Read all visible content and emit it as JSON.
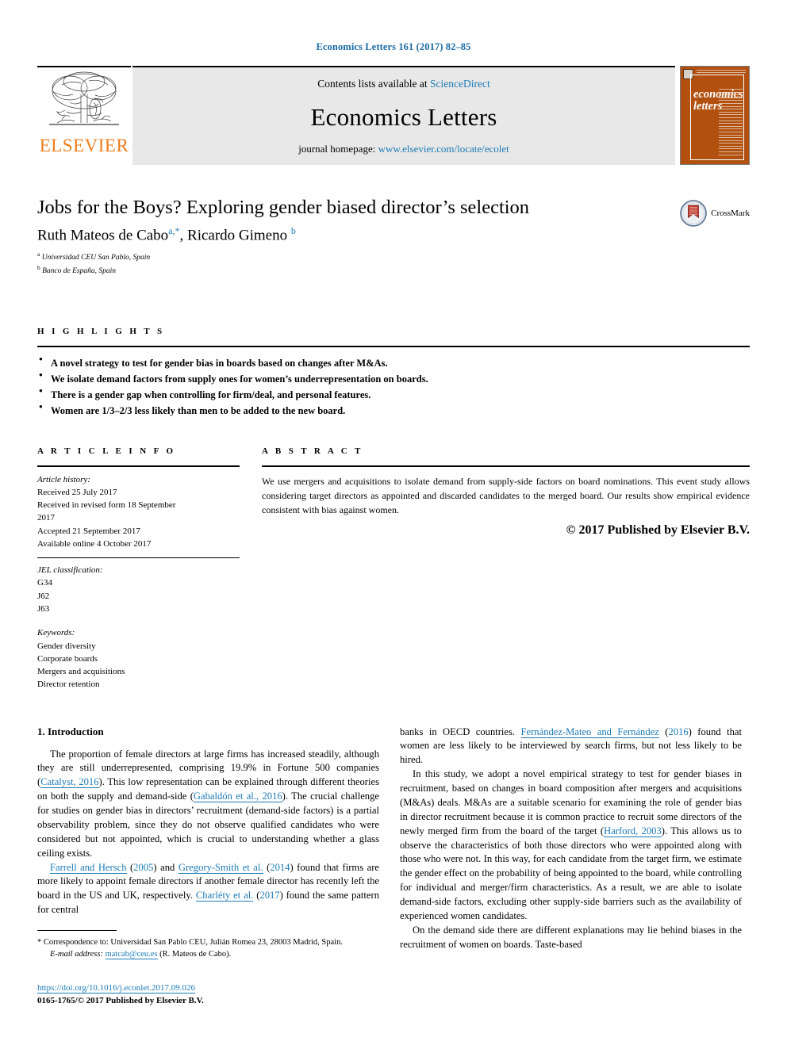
{
  "running_head": "Economics Letters 161 (2017) 82–85",
  "masthead": {
    "publisher": "ELSEVIER",
    "contents_prefix": "Contents lists available at",
    "contents_link": "ScienceDirect",
    "journal_title": "Economics Letters",
    "homepage_prefix": "journal homepage:",
    "homepage_link": "www.elsevier.com/locate/ecolet",
    "cover_title_line1": "economics",
    "cover_title_line2": "letters"
  },
  "article": {
    "title": "Jobs for the Boys? Exploring gender biased director’s selection",
    "authors_part1": "Ruth Mateos de Cabo",
    "author1_sup": "a,*",
    "authors_part2": ", Ricardo Gimeno",
    "author2_sup": "b",
    "affiliations": [
      {
        "sup": "a",
        "text": "Universidad CEU San Pablo, Spain"
      },
      {
        "sup": "b",
        "text": "Banco de España, Spain"
      }
    ],
    "crossmark_label": "CrossMark"
  },
  "highlights": {
    "label": "H I G H L I G H T S",
    "items": [
      "A novel strategy to test for gender bias in boards based on changes after M&As.",
      "We isolate demand factors from supply ones for women’s underrepresentation on boards.",
      "There is a gender gap when controlling for firm/deal, and personal features.",
      "Women are 1/3–2/3 less likely than men to be added to the new board."
    ]
  },
  "article_info": {
    "label": "A R T I C L E   I N F O",
    "history_label": "Article history:",
    "history": [
      "Received 25 July 2017",
      "Received in revised form 18 September",
      "2017",
      "Accepted 21 September 2017",
      "Available online 4 October 2017"
    ],
    "jel_label": "JEL classification:",
    "jel": [
      "G34",
      "J62",
      "J63"
    ],
    "keywords_label": "Keywords:",
    "keywords": [
      "Gender diversity",
      "Corporate boards",
      "Mergers and acquisitions",
      "Director retention"
    ]
  },
  "abstract": {
    "label": "A B S T R A C T",
    "text": "We use mergers and acquisitions to isolate demand from supply-side factors on board nominations. This event study allows considering target directors as appointed and discarded candidates to the merged board. Our results show empirical evidence consistent with bias against women.",
    "copyright": "© 2017 Published by Elsevier B.V."
  },
  "body": {
    "section1_heading": "1. Introduction",
    "left_para1_a": "The proportion of female directors at large firms has increased steadily, although they are still underrepresented, comprising 19.9% in Fortune 500 companies (",
    "left_para1_ref1": "Catalyst, 2016",
    "left_para1_b": "). This low representation can be explained through different theories on both the supply and demand-side (",
    "left_para1_ref2": "Gabaldón et al., 2016",
    "left_para1_c": "). The crucial challenge for studies on gender bias in directors’ recruitment (demand-side factors) is a partial observability problem, since they do not observe qualified candidates who were considered but not appointed, which is crucial to understanding whether a glass ceiling exists.",
    "left_para2_ref1": "Farrell and Hersch",
    "left_para2_a": " (",
    "left_para2_ref1b": "2005",
    "left_para2_b": ") and ",
    "left_para2_ref2": "Gregory-Smith et al.",
    "left_para2_c": " (",
    "left_para2_ref2b": "2014",
    "left_para2_d": ") found that firms are more likely to appoint female directors if another female director has recently left the board in the US and UK, respectively. ",
    "left_para2_ref3": "Charléty et al.",
    "left_para2_e": " (",
    "left_para2_ref3b": "2017",
    "left_para2_f": ") found the same pattern for central",
    "right_para1_a": "banks in OECD countries. ",
    "right_para1_ref1": "Fernández-Mateo and Fernández",
    "right_para1_b": " (",
    "right_para1_ref1b": "2016",
    "right_para1_c": ") found that women are less likely to be interviewed by search firms, but not less likely to be hired.",
    "right_para2_a": "In this study, we adopt a novel empirical strategy to test for gender biases in recruitment, based on changes in board composition after mergers and acquisitions (M&As) deals. M&As are a suitable scenario for examining the role of gender bias in director recruitment because it is common practice to recruit some directors of the newly merged firm from the board of the target (",
    "right_para2_ref1": "Harford, 2003",
    "right_para2_b": "). This allows us to observe the characteristics of both those directors who were appointed along with those who were not. In this way, for each candidate from the target firm, we estimate the gender effect on the probability of being appointed to the board, while controlling for individual and merger/firm characteristics. As a result, we are able to isolate demand-side factors, excluding other supply-side barriers such as the availability of experienced women candidates.",
    "right_para3": "On the demand side there are different explanations may lie behind biases in the recruitment of women on boards. Taste-based"
  },
  "footnotes": {
    "correspondence": "* Correspondence to: Universidad San Pablo CEU, Julián Romea 23, 28003 Madrid, Spain.",
    "email_label": "E-mail address:",
    "email": "matcab@ceu.es",
    "email_suffix": "(R. Mateos de Cabo).",
    "doi": "https://doi.org/10.1016/j.econlet.2017.09.026",
    "issn_copyright": "0165-1765/© 2017 Published by Elsevier B.V."
  },
  "colors": {
    "link": "#1b7ab5",
    "running_head": "#1b6ca8",
    "elsevier_orange": "#ef7d1a",
    "cover_orange": "#b1500f",
    "banner_grey": "#e8e8e8"
  }
}
